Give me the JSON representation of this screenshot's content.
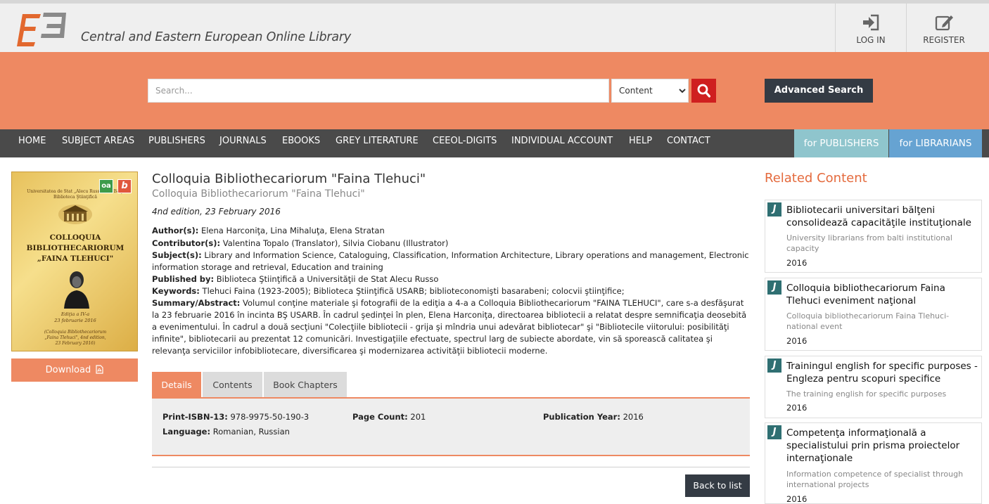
{
  "header": {
    "site_name": "Central and Eastern European Online Library",
    "login_label": "LOG IN",
    "register_label": "REGISTER"
  },
  "search": {
    "placeholder": "Search...",
    "scope_selected": "Content",
    "advanced_label": "Advanced Search"
  },
  "nav": {
    "items": [
      "HOME",
      "SUBJECT AREAS",
      "PUBLISHERS",
      "JOURNALS",
      "EBOOKS",
      "GREY LITERATURE",
      "CEEOL-DIGITS",
      "INDIVIDUAL ACCOUNT",
      "HELP",
      "CONTACT"
    ],
    "for_publishers": "for PUBLISHERS",
    "for_librarians": "for LIBRARIANS"
  },
  "cover": {
    "top_text_1": "Universitatea de Stat „Alecu Russo\" din Bălţi",
    "top_text_2": "Biblioteca Ştiinţifică",
    "title_1": "COLLOQUIA",
    "title_2": "BIBLIOTHECARIORUM",
    "title_3": "„FAINA TLEHUCI\"",
    "edition_1": "Ediţia a IV-a",
    "edition_2": "23 februarie 2016",
    "foot_1": "(Colloquia Bibliothecariorum",
    "foot_2": "„Faina Tlehuci\", 4nd edition,",
    "foot_3": "23 February 2016)",
    "oa_badge": "oa",
    "b_badge": "b"
  },
  "download_label": "Download",
  "book": {
    "title": "Colloquia Bibliothecariorum \"Faina Tlehuci\"",
    "subtitle": "Colloquia Bibliothecariorum \"Faina Tlehuci\"",
    "edition": "4nd edition, 23 February 2016",
    "authors_label": "Author(s):",
    "authors": "Elena Harconiţa, Lina Mihaluţa, Elena Stratan",
    "contributors_label": "Contributor(s):",
    "contributors": "Valentina Topalo (Translator), Silvia Ciobanu (Illustrator)",
    "subjects_label": "Subject(s):",
    "subjects": "Library and Information Science, Cataloguing, Classification, Information Architecture, Library operations and management, Electronic information storage and retrieval, Education and training",
    "published_label": "Published by:",
    "published": "Biblioteca Ştiinţifică a Universităţii de Stat Alecu Russo",
    "keywords_label": "Keywords:",
    "keywords": "Tlehuci Faina (1923-2005); Biblioteca Ştiinţifică USARB; biblioteconomişti basarabeni; colocvii ştiinţifice;",
    "summary_label": "Summary/Abstract:",
    "summary": "Volumul conţine materiale şi fotografii de la ediţia a 4-a a Colloquia Bibliothecariorum \"FAINA TLEHUCI\", care s-a desfăşurat la 23 februarie 2016 în incinta BŞ USARB. În cadrul şedinţei în plen, Elena Harconiţa, directoarea bibliotecii a relatat despre semnificaţia deosebită a evenimentului. În cadrul a două secţiuni \"Colecţiile bibliotecii - grija şi mîndria unui adevărat bibliotecar\" şi \"Bibliotecile viitorului: posibilităţi infinite\", bibliotecarii au prezentat 12 comunicări. Investigaţiile efectuate, spectrul larg de subiecte abordate, vin să sporească calitatea şi relevanţa serviciilor infobibliotecare, diversificarea şi modernizarea activităţii bibliotecii moderne."
  },
  "tabs": {
    "details": "Details",
    "contents": "Contents",
    "chapters": "Book Chapters"
  },
  "details": {
    "isbn_label": "Print-ISBN-13:",
    "isbn": "978-9975-50-190-3",
    "pagecount_label": "Page Count:",
    "pagecount": "201",
    "pubyear_label": "Publication Year:",
    "pubyear": "2016",
    "language_label": "Language:",
    "language": "Romanian, Russian"
  },
  "back_label": "Back to list",
  "related": {
    "title": "Related Content",
    "items": [
      {
        "title": "Bibliotecarii universitari bălţeni consolidează capacităţile instituţionale",
        "subtitle": "University librarians from balti institutional capacity",
        "year": "2016"
      },
      {
        "title": "Colloquia bibliothecariorum Faina Tlehuci eveniment naţional",
        "subtitle": "Colloquia bibliothecariorum Faina Tlehuci- national event",
        "year": "2016"
      },
      {
        "title": "Trainingul english for specific purposes - Engleza pentru scopuri specifice",
        "subtitle": "The training english for specific purposes",
        "year": "2016"
      },
      {
        "title": "Competenţa informaţională a specialistului prin prisma proiectelor internaţionale",
        "subtitle": "Information competence of specialist through international projects",
        "year": "2016"
      }
    ]
  }
}
